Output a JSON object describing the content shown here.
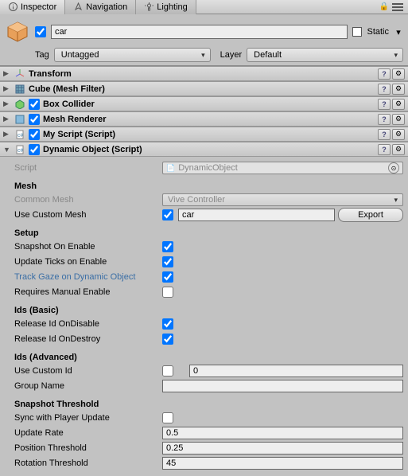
{
  "tabs": {
    "inspector": "Inspector",
    "navigation": "Navigation",
    "lighting": "Lighting"
  },
  "header": {
    "name_value": "car",
    "active_checked": true,
    "static_label": "Static",
    "static_checked": false,
    "tag_label": "Tag",
    "tag_value": "Untagged",
    "layer_label": "Layer",
    "layer_value": "Default"
  },
  "components": [
    {
      "title": "Transform",
      "checkbox": null,
      "expanded": false
    },
    {
      "title": "Cube (Mesh Filter)",
      "checkbox": null,
      "expanded": false
    },
    {
      "title": "Box Collider",
      "checkbox": true,
      "expanded": false
    },
    {
      "title": "Mesh Renderer",
      "checkbox": true,
      "expanded": false
    },
    {
      "title": "My Script (Script)",
      "checkbox": true,
      "expanded": false
    }
  ],
  "dyn": {
    "title": "Dynamic Object (Script)",
    "checked": true,
    "script_label": "Script",
    "script_value": "DynamicObject",
    "mesh_heading": "Mesh",
    "common_mesh_label": "Common Mesh",
    "common_mesh_value": "Vive Controller",
    "use_custom_mesh_label": "Use Custom Mesh",
    "use_custom_mesh_checked": true,
    "mesh_name_value": "car",
    "export_label": "Export",
    "setup_heading": "Setup",
    "snapshot_on_enable_label": "Snapshot On Enable",
    "snapshot_on_enable_checked": true,
    "update_ticks_label": "Update Ticks on Enable",
    "update_ticks_checked": true,
    "track_gaze_label": "Track Gaze on Dynamic Object",
    "track_gaze_checked": true,
    "requires_manual_label": "Requires Manual Enable",
    "requires_manual_checked": false,
    "ids_basic_heading": "Ids (Basic)",
    "release_disable_label": "Release Id OnDisable",
    "release_disable_checked": true,
    "release_destroy_label": "Release Id OnDestroy",
    "release_destroy_checked": true,
    "ids_adv_heading": "Ids (Advanced)",
    "use_custom_id_label": "Use Custom Id",
    "use_custom_id_checked": false,
    "custom_id_value": "0",
    "group_name_label": "Group Name",
    "group_name_value": "",
    "snapshot_threshold_heading": "Snapshot Threshold",
    "sync_label": "Sync with Player Update",
    "sync_checked": false,
    "update_rate_label": "Update Rate",
    "update_rate_value": "0.5",
    "pos_thresh_label": "Position Threshold",
    "pos_thresh_value": "0.25",
    "rot_thresh_label": "Rotation Threshold",
    "rot_thresh_value": "45"
  }
}
